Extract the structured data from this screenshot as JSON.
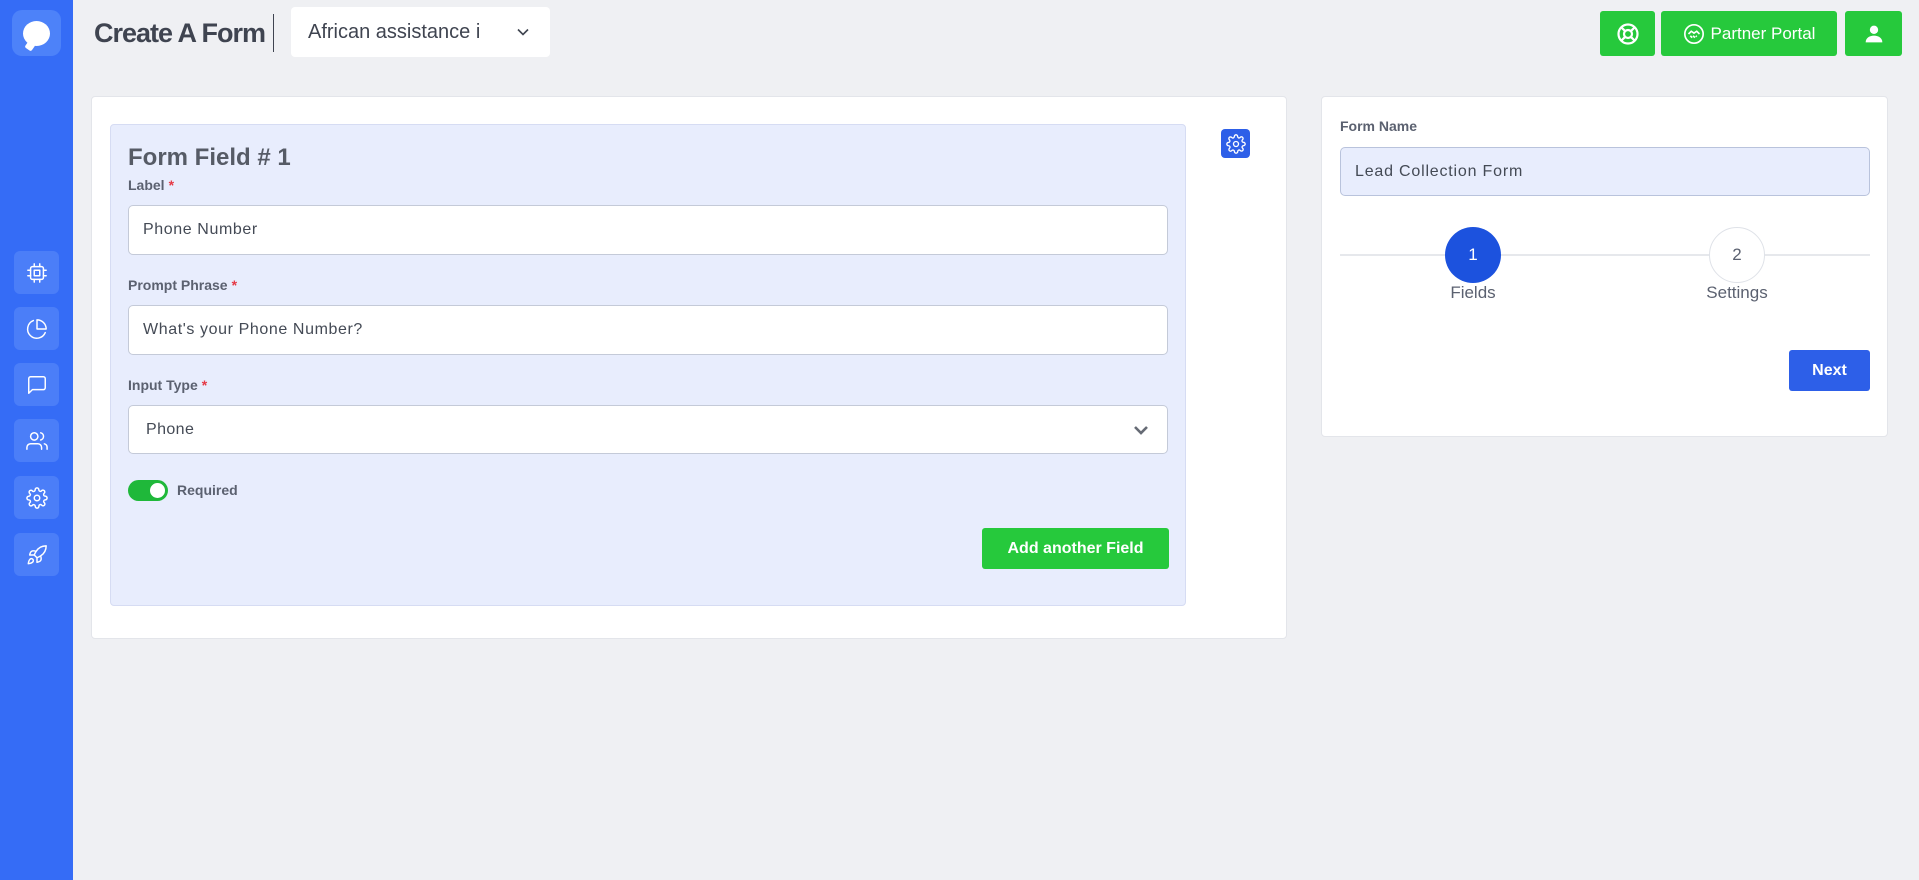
{
  "header": {
    "title": "Create A Form",
    "project_select": "African assistance i",
    "partner_portal": "Partner Portal"
  },
  "sidebar": {
    "items": [
      {
        "name": "cpu-icon"
      },
      {
        "name": "pie-chart-icon"
      },
      {
        "name": "message-icon"
      },
      {
        "name": "users-icon"
      },
      {
        "name": "gear-icon"
      },
      {
        "name": "rocket-icon"
      }
    ]
  },
  "form_field": {
    "title": "Form Field # 1",
    "label_label": "Label",
    "label_value": "Phone Number",
    "prompt_label": "Prompt Phrase",
    "prompt_value": "What's your Phone Number?",
    "input_type_label": "Input Type",
    "input_type_value": "Phone",
    "required_asterisk": "*",
    "required_label": "Required",
    "required_on": true,
    "add_button": "Add another Field"
  },
  "form_settings": {
    "form_name_label": "Form Name",
    "form_name_value": "Lead Collection Form",
    "steps": [
      {
        "number": "1",
        "label": "Fields",
        "active": true
      },
      {
        "number": "2",
        "label": "Settings",
        "active": false
      }
    ],
    "next_button": "Next"
  },
  "colors": {
    "sidebar": "#356cf6",
    "accent_green": "#26c93c",
    "accent_blue": "#2d5fe8"
  }
}
